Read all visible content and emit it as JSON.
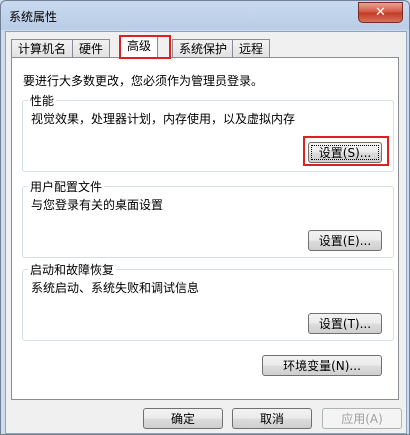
{
  "window": {
    "title": "系统属性",
    "close_glyph": "✕"
  },
  "tabs": [
    {
      "label": "计算机名"
    },
    {
      "label": "硬件"
    },
    {
      "label": "高级"
    },
    {
      "label": "系统保护"
    },
    {
      "label": "远程"
    }
  ],
  "active_tab": "高级",
  "admin_note": "要进行大多数更改，您必须作为管理员登录。",
  "performance": {
    "title": "性能",
    "description": "视觉效果，处理器计划，内存使用，以及虚拟内存",
    "button": "设置(S)..."
  },
  "user_profiles": {
    "title": "用户配置文件",
    "description": "与您登录有关的桌面设置",
    "button": "设置(E)..."
  },
  "startup_recovery": {
    "title": "启动和故障恢复",
    "description": "系统启动、系统失败和调试信息",
    "button": "设置(T)..."
  },
  "env_button": "环境变量(N)...",
  "footer": {
    "ok": "确定",
    "cancel": "取消",
    "apply": "应用(A)"
  },
  "colors": {
    "highlight": "#e02020",
    "titlebar": "#b9cde6",
    "close": "#c9472f"
  }
}
